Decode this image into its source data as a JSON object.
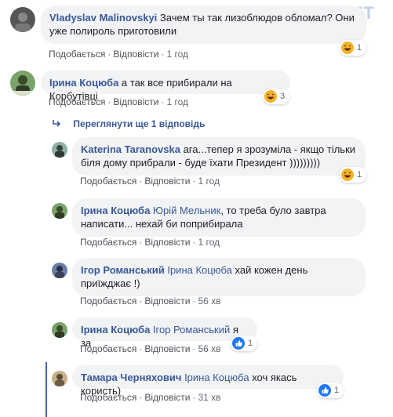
{
  "watermark": "TIMES.ZT",
  "labels": {
    "like": "Подобається",
    "reply": "Відповісти"
  },
  "view_more": "Переглянути ще 1 відповідь",
  "colors": {
    "link": "#385898",
    "bubble": "#f2f3f5",
    "accent": "#4267b2"
  },
  "comments": [
    {
      "author": "Vladyslav Malinovskyi",
      "mention": "",
      "text": "Зачем ты так лизоблюдов обломал? Они уже полироль приготовили",
      "time": "1 год",
      "reaction": {
        "icon": "laugh-emoji",
        "count": "1"
      }
    },
    {
      "author": "Ірина Коцюба",
      "mention": "",
      "text": "а так все прибирали на Корбутівці",
      "time": "1 год",
      "reaction": {
        "icon": "laugh-emoji",
        "count": "3"
      }
    },
    {
      "author": "Katerina Taranovska",
      "mention": "",
      "text": "ага...тепер я зрозуміла - якщо тільки біля дому прибрали - буде їхати Президент )))))))))",
      "time": "1 год",
      "reaction": {
        "icon": "laugh-emoji",
        "count": "1"
      }
    },
    {
      "author": "Ірина Коцюба",
      "mention": "Юрій Мельник",
      "text": ", то треба було завтра написати... нехай би поприбирала",
      "time": "1 год",
      "reaction": null
    },
    {
      "author": "Ігор Романський",
      "mention": "Ірина Коцюба",
      "text": "хай кожен день приїжджає !)",
      "time": "56 хв",
      "reaction": null
    },
    {
      "author": "Ірина Коцюба",
      "mention": "Ігор Романський",
      "text": "я за",
      "time": "56 хв",
      "reaction": {
        "icon": "like-icon",
        "count": "1"
      }
    },
    {
      "author": "Тамара Черняхович",
      "mention": "Ірина Коцюба",
      "text": "хоч якась користь)",
      "time": "31 хв",
      "reaction": {
        "icon": "like-icon",
        "count": "1"
      }
    }
  ]
}
